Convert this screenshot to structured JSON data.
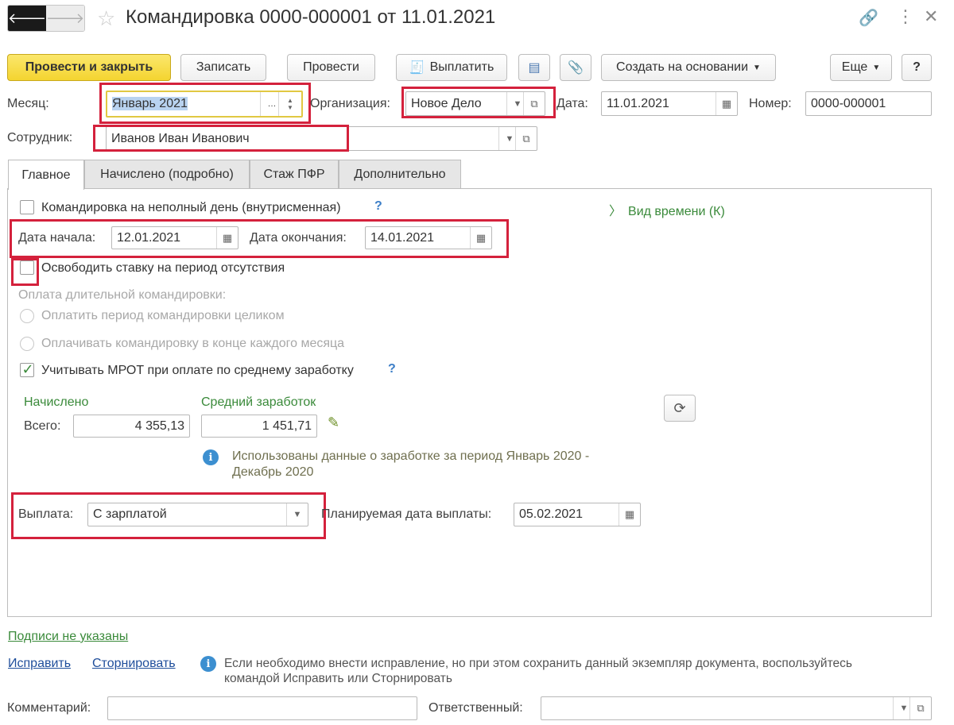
{
  "window": {
    "title": "Командировка 0000-000001 от 11.01.2021"
  },
  "toolbar": {
    "post_close": "Провести и закрыть",
    "save": "Записать",
    "post": "Провести",
    "pay": "Выплатить",
    "create_based": "Создать на основании",
    "more": "Еще",
    "help": "?"
  },
  "header": {
    "month_label": "Месяц:",
    "month_value": "Январь 2021",
    "org_label": "Организация:",
    "org_value": "Новое Дело",
    "date_label": "Дата:",
    "date_value": "11.01.2021",
    "number_label": "Номер:",
    "number_value": "0000-000001",
    "employee_label": "Сотрудник:",
    "employee_value": "Иванов Иван Иванович"
  },
  "tabs": [
    {
      "label": "Главное"
    },
    {
      "label": "Начислено (подробно)"
    },
    {
      "label": "Стаж ПФР"
    },
    {
      "label": "Дополнительно"
    }
  ],
  "main": {
    "partial_day_label": "Командировка на неполный день (внутрисменная)",
    "partial_day_help": "?",
    "time_type_link": "Вид времени (К)",
    "start_label": "Дата начала:",
    "start_value": "12.01.2021",
    "end_label": "Дата окончания:",
    "end_value": "14.01.2021",
    "free_rate_label": "Освободить ставку на период отсутствия",
    "long_trip_label": "Оплата длительной командировки:",
    "pay_whole_label": "Оплатить период командировки целиком",
    "pay_monthly_label": "Оплачивать командировку в конце каждого месяца",
    "mrot_label": "Учитывать МРОТ при оплате по среднему заработку",
    "mrot_help": "?",
    "accrued_header": "Начислено",
    "avg_header": "Средний заработок",
    "total_label": "Всего:",
    "total_value": "4 355,13",
    "avg_value": "1 451,71",
    "info_text_line1": "Использованы данные о заработке за период Январь 2020 -",
    "info_text_line2": "Декабрь 2020",
    "payout_label": "Выплата:",
    "payout_value": "С зарплатой",
    "planned_date_label": "Планируемая дата выплаты:",
    "planned_date_value": "05.02.2021"
  },
  "footer": {
    "signatures_link": "Подписи не указаны",
    "fix_link": "Исправить",
    "storno_link": "Сторнировать",
    "hint_line1": "Если необходимо внести исправление, но при этом сохранить данный экземпляр документа, воспользуйтесь",
    "hint_line2": "командой Исправить или Сторнировать",
    "comment_label": "Комментарий:",
    "comment_value": "",
    "responsible_label": "Ответственный:",
    "responsible_value": ""
  },
  "colors": {
    "accent_yellow": "#f4d430",
    "highlight_red": "#d4213c",
    "link_blue": "#1f4e9b",
    "green_text": "#3a8a3a"
  }
}
